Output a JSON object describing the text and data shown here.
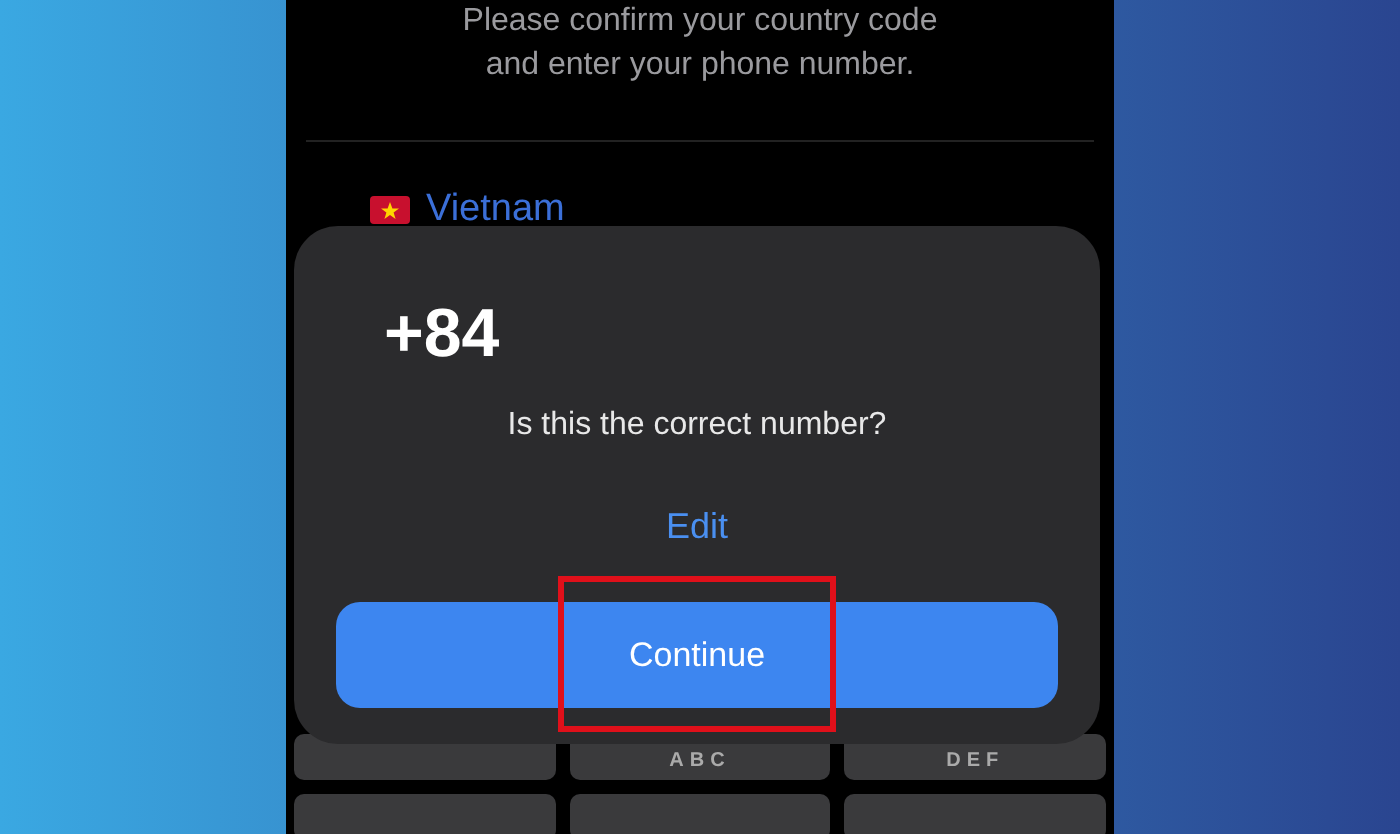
{
  "intro": {
    "lines": [
      "Please confirm your country code",
      "and enter your phone number."
    ]
  },
  "country": {
    "name": "Vietnam"
  },
  "dialog": {
    "code": "+84",
    "question": "Is this the correct number?",
    "edit": "Edit",
    "continue": "Continue",
    "highlighted": true
  },
  "keypad": [
    {
      "kind": "key"
    },
    {
      "kind": "key",
      "letters": "ABC"
    },
    {
      "kind": "key",
      "letters": "DEF"
    },
    {
      "kind": "key"
    },
    {
      "kind": "key"
    },
    {
      "kind": "key"
    }
  ]
}
